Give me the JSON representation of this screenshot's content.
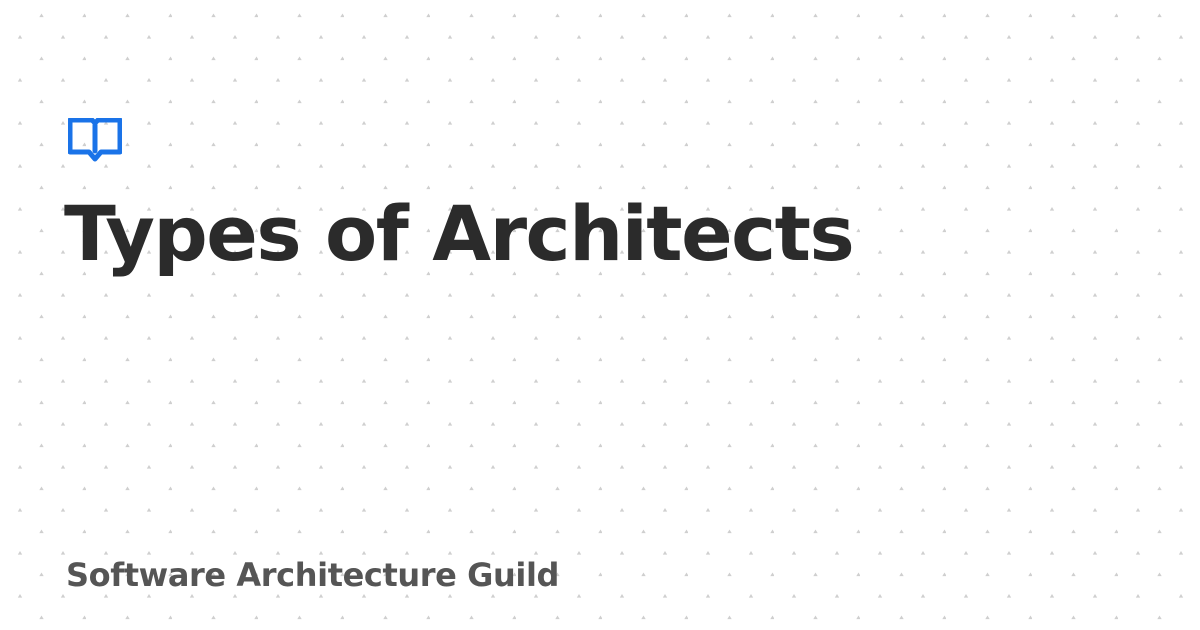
{
  "page": {
    "title": "Types of Architects",
    "site_name": "Software Architecture Guild"
  },
  "logo": {
    "icon": "book-open-icon"
  },
  "colors": {
    "background": "#ffffff",
    "title_text": "#2b2b2b",
    "site_name_text": "#555555",
    "accent": "#1a73e8",
    "pattern_dots": "#cfcfcf"
  }
}
